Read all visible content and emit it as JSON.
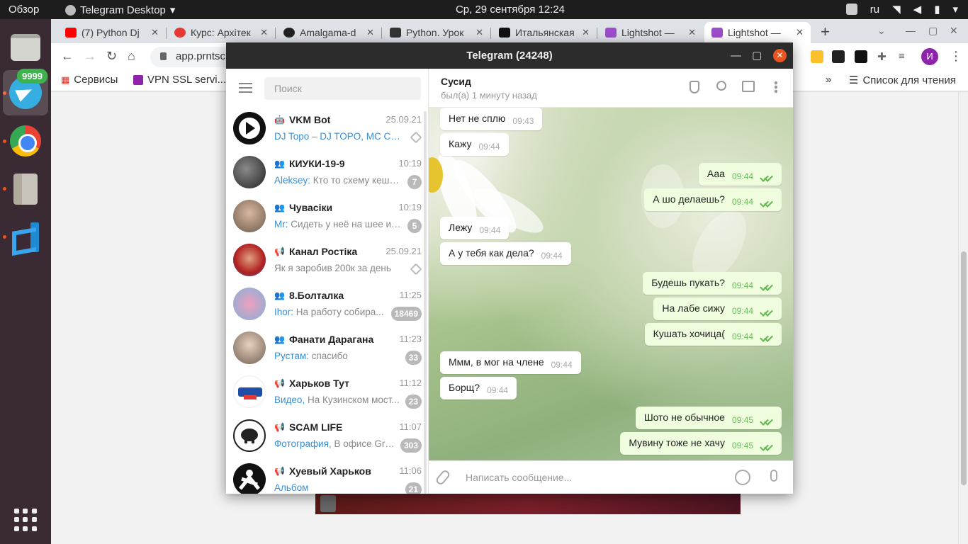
{
  "topbar": {
    "overview": "Обзор",
    "app_name": "Telegram Desktop",
    "clock": "Ср, 29 сентября  12:24",
    "lang": "ru"
  },
  "dock": {
    "telegram_badge": "9999"
  },
  "browser": {
    "tabs": [
      {
        "title": "(7) Python Dj",
        "color": "#ff0000"
      },
      {
        "title": "Курс: Архітек",
        "color": "#e53935"
      },
      {
        "title": "Amalgama-d",
        "color": "#222222"
      },
      {
        "title": "Python. Урок",
        "color": "#333333"
      },
      {
        "title": "Итальянская",
        "color": "#111111"
      },
      {
        "title": "Lightshot —",
        "color": "#9b4dca"
      },
      {
        "title": "Lightshot —",
        "color": "#9b4dca"
      }
    ],
    "address": "app.prntscr",
    "avatar_letter": "И",
    "bookmarks": {
      "services": "Сервисы",
      "vpn": "VPN SSL servi...",
      "overflow": "»",
      "reading_list": "Список для чтения"
    }
  },
  "telegram": {
    "window_title": "Telegram (24248)",
    "search_placeholder": "Поиск",
    "chats": [
      {
        "name": "VKM Bot",
        "kind": "bot",
        "time": "25.09.21",
        "sender": "",
        "preview": "DJ Topo – DJ TOPO, MC CYCL...",
        "count": "",
        "pinned": true,
        "preview_colored": true
      },
      {
        "name": "КИУКИ-19-9",
        "kind": "group",
        "time": "10:19",
        "sender": "Aleksey:",
        "preview": "Кто то схему кеша ...",
        "count": "7",
        "pinned": false
      },
      {
        "name": "Чувасіки",
        "kind": "group",
        "time": "10:19",
        "sender": "Mr:",
        "preview": "Сидеть у неё на шее и ...",
        "count": "5",
        "pinned": false
      },
      {
        "name": "Канал Ростіка",
        "kind": "channel",
        "time": "25.09.21",
        "sender": "",
        "preview": "Як я заробив 200к за день",
        "count": "",
        "pinned": true
      },
      {
        "name": "8.Болталка",
        "kind": "group",
        "time": "11:25",
        "sender": "Ihor:",
        "preview": "На работу собира...",
        "count": "18469",
        "pinned": false
      },
      {
        "name": "Фанати Дарагана",
        "kind": "group",
        "time": "11:23",
        "sender": "Рустам:",
        "preview": "спасибо",
        "count": "33",
        "pinned": false
      },
      {
        "name": "Харьков Тут",
        "kind": "channel",
        "time": "11:12",
        "sender": "Видео,",
        "preview": "На Кузинском мост...",
        "count": "23",
        "pinned": false
      },
      {
        "name": "SCAM LIFE",
        "kind": "channel",
        "time": "11:07",
        "sender": "Фотография,",
        "preview": "В офисе Gro...",
        "count": "303",
        "pinned": false
      },
      {
        "name": "Хуевый Харьков",
        "kind": "channel",
        "time": "11:06",
        "sender": "Альбом",
        "preview": "",
        "count": "21",
        "pinned": false
      }
    ],
    "chat": {
      "title": "Сусид",
      "status": "был(а) 1 минуту назад",
      "composer_placeholder": "Написать сообщение..."
    },
    "messages": [
      {
        "text": "Нет не сплю",
        "time": "09:43",
        "dir": "in"
      },
      {
        "text": "Кажу",
        "time": "09:44",
        "dir": "in"
      },
      {
        "text": "Ааа",
        "time": "09:44",
        "dir": "out"
      },
      {
        "text": "А шо делаешь?",
        "time": "09:44",
        "dir": "out"
      },
      {
        "text": "Лежу",
        "time": "09:44",
        "dir": "in"
      },
      {
        "text": "А у тебя как дела?",
        "time": "09:44",
        "dir": "in"
      },
      {
        "text": "Будешь пукать?",
        "time": "09:44",
        "dir": "out"
      },
      {
        "text": "На лабе сижу",
        "time": "09:44",
        "dir": "out"
      },
      {
        "text": "Кушать хочица(",
        "time": "09:44",
        "dir": "out"
      },
      {
        "text": "Ммм, в мог на члене",
        "time": "09:44",
        "dir": "in"
      },
      {
        "text": "Борщ?",
        "time": "09:44",
        "dir": "in"
      },
      {
        "text": "Шото не обычное",
        "time": "09:45",
        "dir": "out"
      },
      {
        "text": "Мувину тоже не хачу",
        "time": "09:45",
        "dir": "out"
      }
    ]
  }
}
